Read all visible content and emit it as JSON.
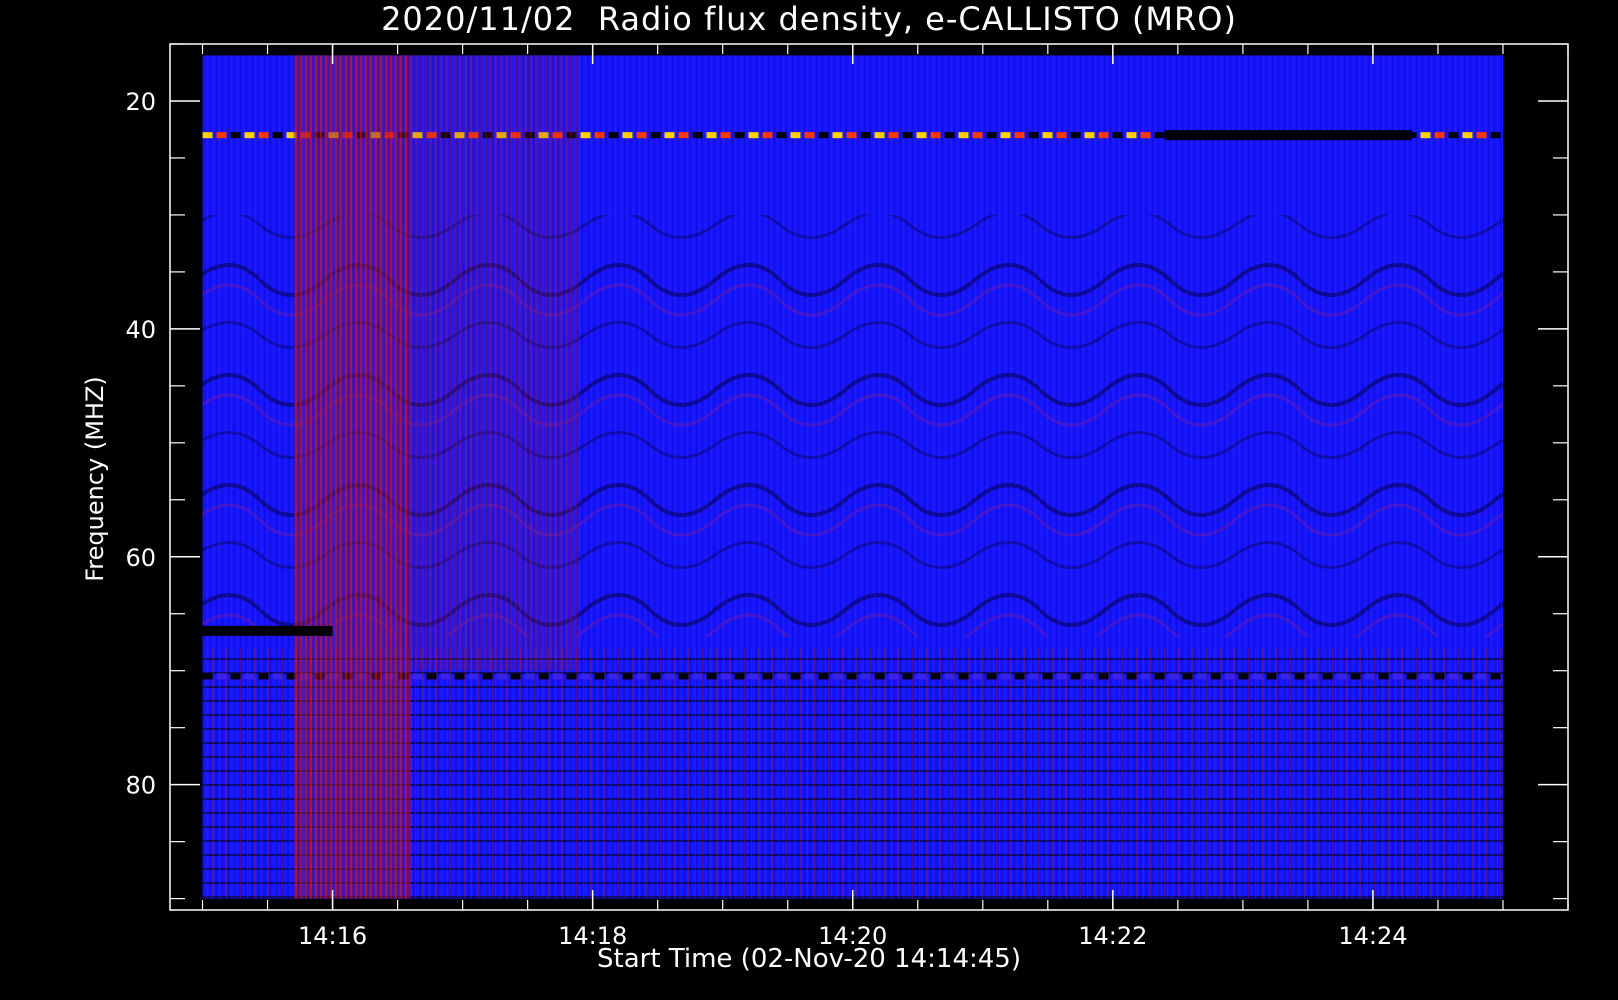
{
  "chart_data": {
    "type": "heatmap",
    "title": "2020/11/02  Radio flux density, e-CALLISTO (MRO)",
    "xlabel": "Start Time (02-Nov-20 14:14:45)",
    "ylabel": "Frequency (MHZ)",
    "x_ticks": [
      "14:16",
      "14:18",
      "14:20",
      "14:22",
      "14:24"
    ],
    "y_ticks": [
      20,
      40,
      60,
      80
    ],
    "ylim": [
      91,
      15
    ],
    "xlim_minutes_after_1400": [
      14.75,
      25.5
    ],
    "data_extent_minutes_after_1400": [
      15.0,
      25.0
    ],
    "data_extent_mhz": [
      16,
      90
    ],
    "colormap": [
      "#000000",
      "#1414ff",
      "#3a22e8",
      "#c81400",
      "#ff3a00",
      "#ffd200",
      "#ffffff"
    ],
    "background_level": "blue",
    "features": [
      {
        "type": "band",
        "mhz": 23,
        "level": "bright-dashed",
        "minutes": [
          15.0,
          25.0
        ]
      },
      {
        "type": "band",
        "mhz": 70.5,
        "level": "dark-dashed",
        "minutes": [
          15.0,
          25.0
        ]
      },
      {
        "type": "burst",
        "minutes": [
          15.7,
          16.6
        ],
        "mhz": [
          16,
          90
        ],
        "level": "red"
      },
      {
        "type": "burst",
        "minutes": [
          16.6,
          17.9
        ],
        "mhz": [
          16,
          70
        ],
        "level": "red-faint"
      },
      {
        "type": "black-segment",
        "minutes": [
          15.0,
          16.0
        ],
        "mhz": 66.5
      },
      {
        "type": "black-segment",
        "minutes": [
          22.4,
          24.3
        ],
        "mhz": 23
      }
    ]
  }
}
